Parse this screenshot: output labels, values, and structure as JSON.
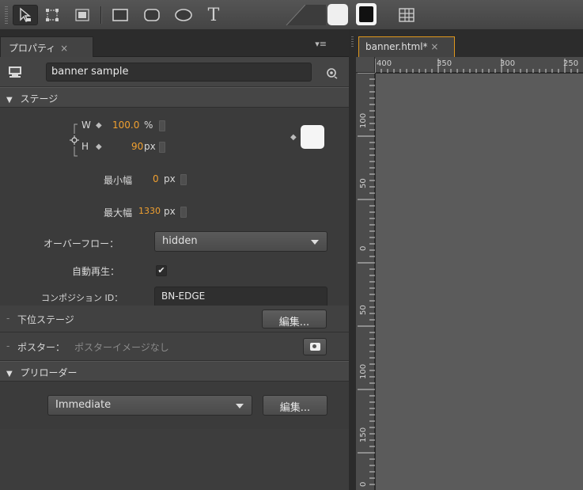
{
  "toolbar": {
    "tools": [
      "selection-tool",
      "transform-tool",
      "clipping-tool",
      "rectangle-tool",
      "rounded-rectangle-tool",
      "ellipse-tool",
      "text-tool",
      "grid-tool"
    ],
    "text_tool_glyph": "T"
  },
  "properties_panel": {
    "tab_label": "プロパティ",
    "tab_close": "×",
    "menu_glyph": "▾≡",
    "composition_name": "banner sample",
    "stage_section": "ステージ",
    "width_label": "W",
    "width_value": "100.0",
    "width_unit": "%",
    "height_label": "H",
    "height_value": "90",
    "height_unit": "px",
    "min_width_label": "最小幅",
    "min_width_value": "0",
    "min_width_unit": "px",
    "max_width_label": "最大幅",
    "max_width_value": "1330",
    "max_width_unit": "px",
    "overflow_label": "オーバーフロー：",
    "overflow_value": "hidden",
    "autoplay_label": "自動再生：",
    "autoplay_checked": true,
    "composition_id_label": "コンポジション ID：",
    "composition_id_value": "BN-EDGE",
    "substage_label": "下位ステージ",
    "substage_edit": "編集...",
    "poster_label": "ポスター：",
    "poster_value": "ポスターイメージなし",
    "preloader_section": "プリローダー",
    "preloader_value": "Immediate",
    "preloader_edit": "編集...",
    "stage_color": "#f5f5f5"
  },
  "document": {
    "tab_label": "banner.html*",
    "tab_close": "×",
    "ruler_h": [
      "400",
      "350",
      "300",
      "250"
    ],
    "ruler_v": [
      "100",
      "50",
      "0",
      "50",
      "100",
      "150",
      "0"
    ]
  },
  "colors": {
    "accent_orange": "#f0a030",
    "active_tab_border": "#e0981c"
  }
}
